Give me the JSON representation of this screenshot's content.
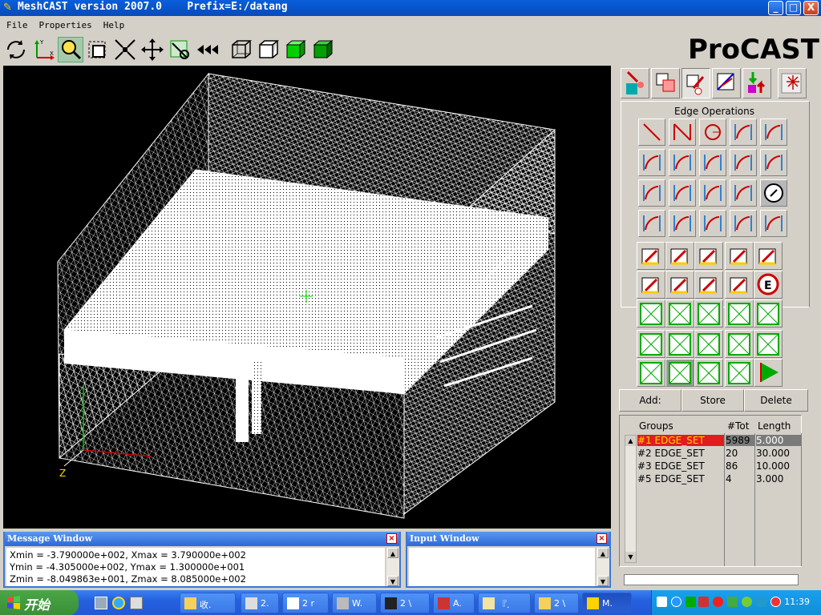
{
  "window": {
    "title": "MeshCAST version 2007.0    Prefix=E:/datang",
    "minimize": "_",
    "maximize": "□",
    "close": "X"
  },
  "menu": [
    "File",
    "Properties",
    "Help"
  ],
  "toolbar": [
    "rotate-icon",
    "axes-icon",
    "zoom-icon",
    "select-box-icon",
    "shrink-icon",
    "pan-icon",
    "pick-icon",
    "rewind-icon",
    "wireframe-cube-icon",
    "hidden-cube-icon",
    "shaded-cube-icon",
    "solid-cube-icon"
  ],
  "logo": "ProCAST",
  "viewport": {
    "axis_label": "Z"
  },
  "right_panel": {
    "section_title": "Edge Operations",
    "actions": {
      "add": "Add:",
      "store": "Store",
      "delete": "Delete"
    },
    "groups_headers": {
      "groups": "Groups",
      "tot": "#Tot",
      "length": "Length"
    },
    "groups": [
      {
        "name": "#1  EDGE_SET",
        "tot": "5989",
        "length": "5.000",
        "selected": true
      },
      {
        "name": "#2  EDGE_SET",
        "tot": "20",
        "length": "30.000",
        "selected": false
      },
      {
        "name": "#3  EDGE_SET",
        "tot": "86",
        "length": "10.000",
        "selected": false
      },
      {
        "name": "#5  EDGE_SET",
        "tot": "4",
        "length": "3.000",
        "selected": false
      }
    ]
  },
  "message_window": {
    "title": "Message Window",
    "lines": [
      "Xmin = -3.790000e+002,  Xmax = 3.790000e+002",
      "Ymin = -4.305000e+002,  Ymax = 1.300000e+001",
      "Zmin = -8.049863e+001,  Zmax = 8.085000e+002"
    ]
  },
  "input_window": {
    "title": "Input Window"
  },
  "taskbar": {
    "start": "开始",
    "tasks": [
      "收.",
      "2.",
      "2 r",
      "W.",
      "2 \\",
      "A.",
      "『.",
      "2 \\",
      "M."
    ],
    "clock": "11:39"
  },
  "colors": {
    "selection": "#e01c1c",
    "selection_text": "#ffd700",
    "highlight_gray": "#7a7a7a",
    "viewport_bg": "#000000",
    "mesh": "#ffffff"
  }
}
